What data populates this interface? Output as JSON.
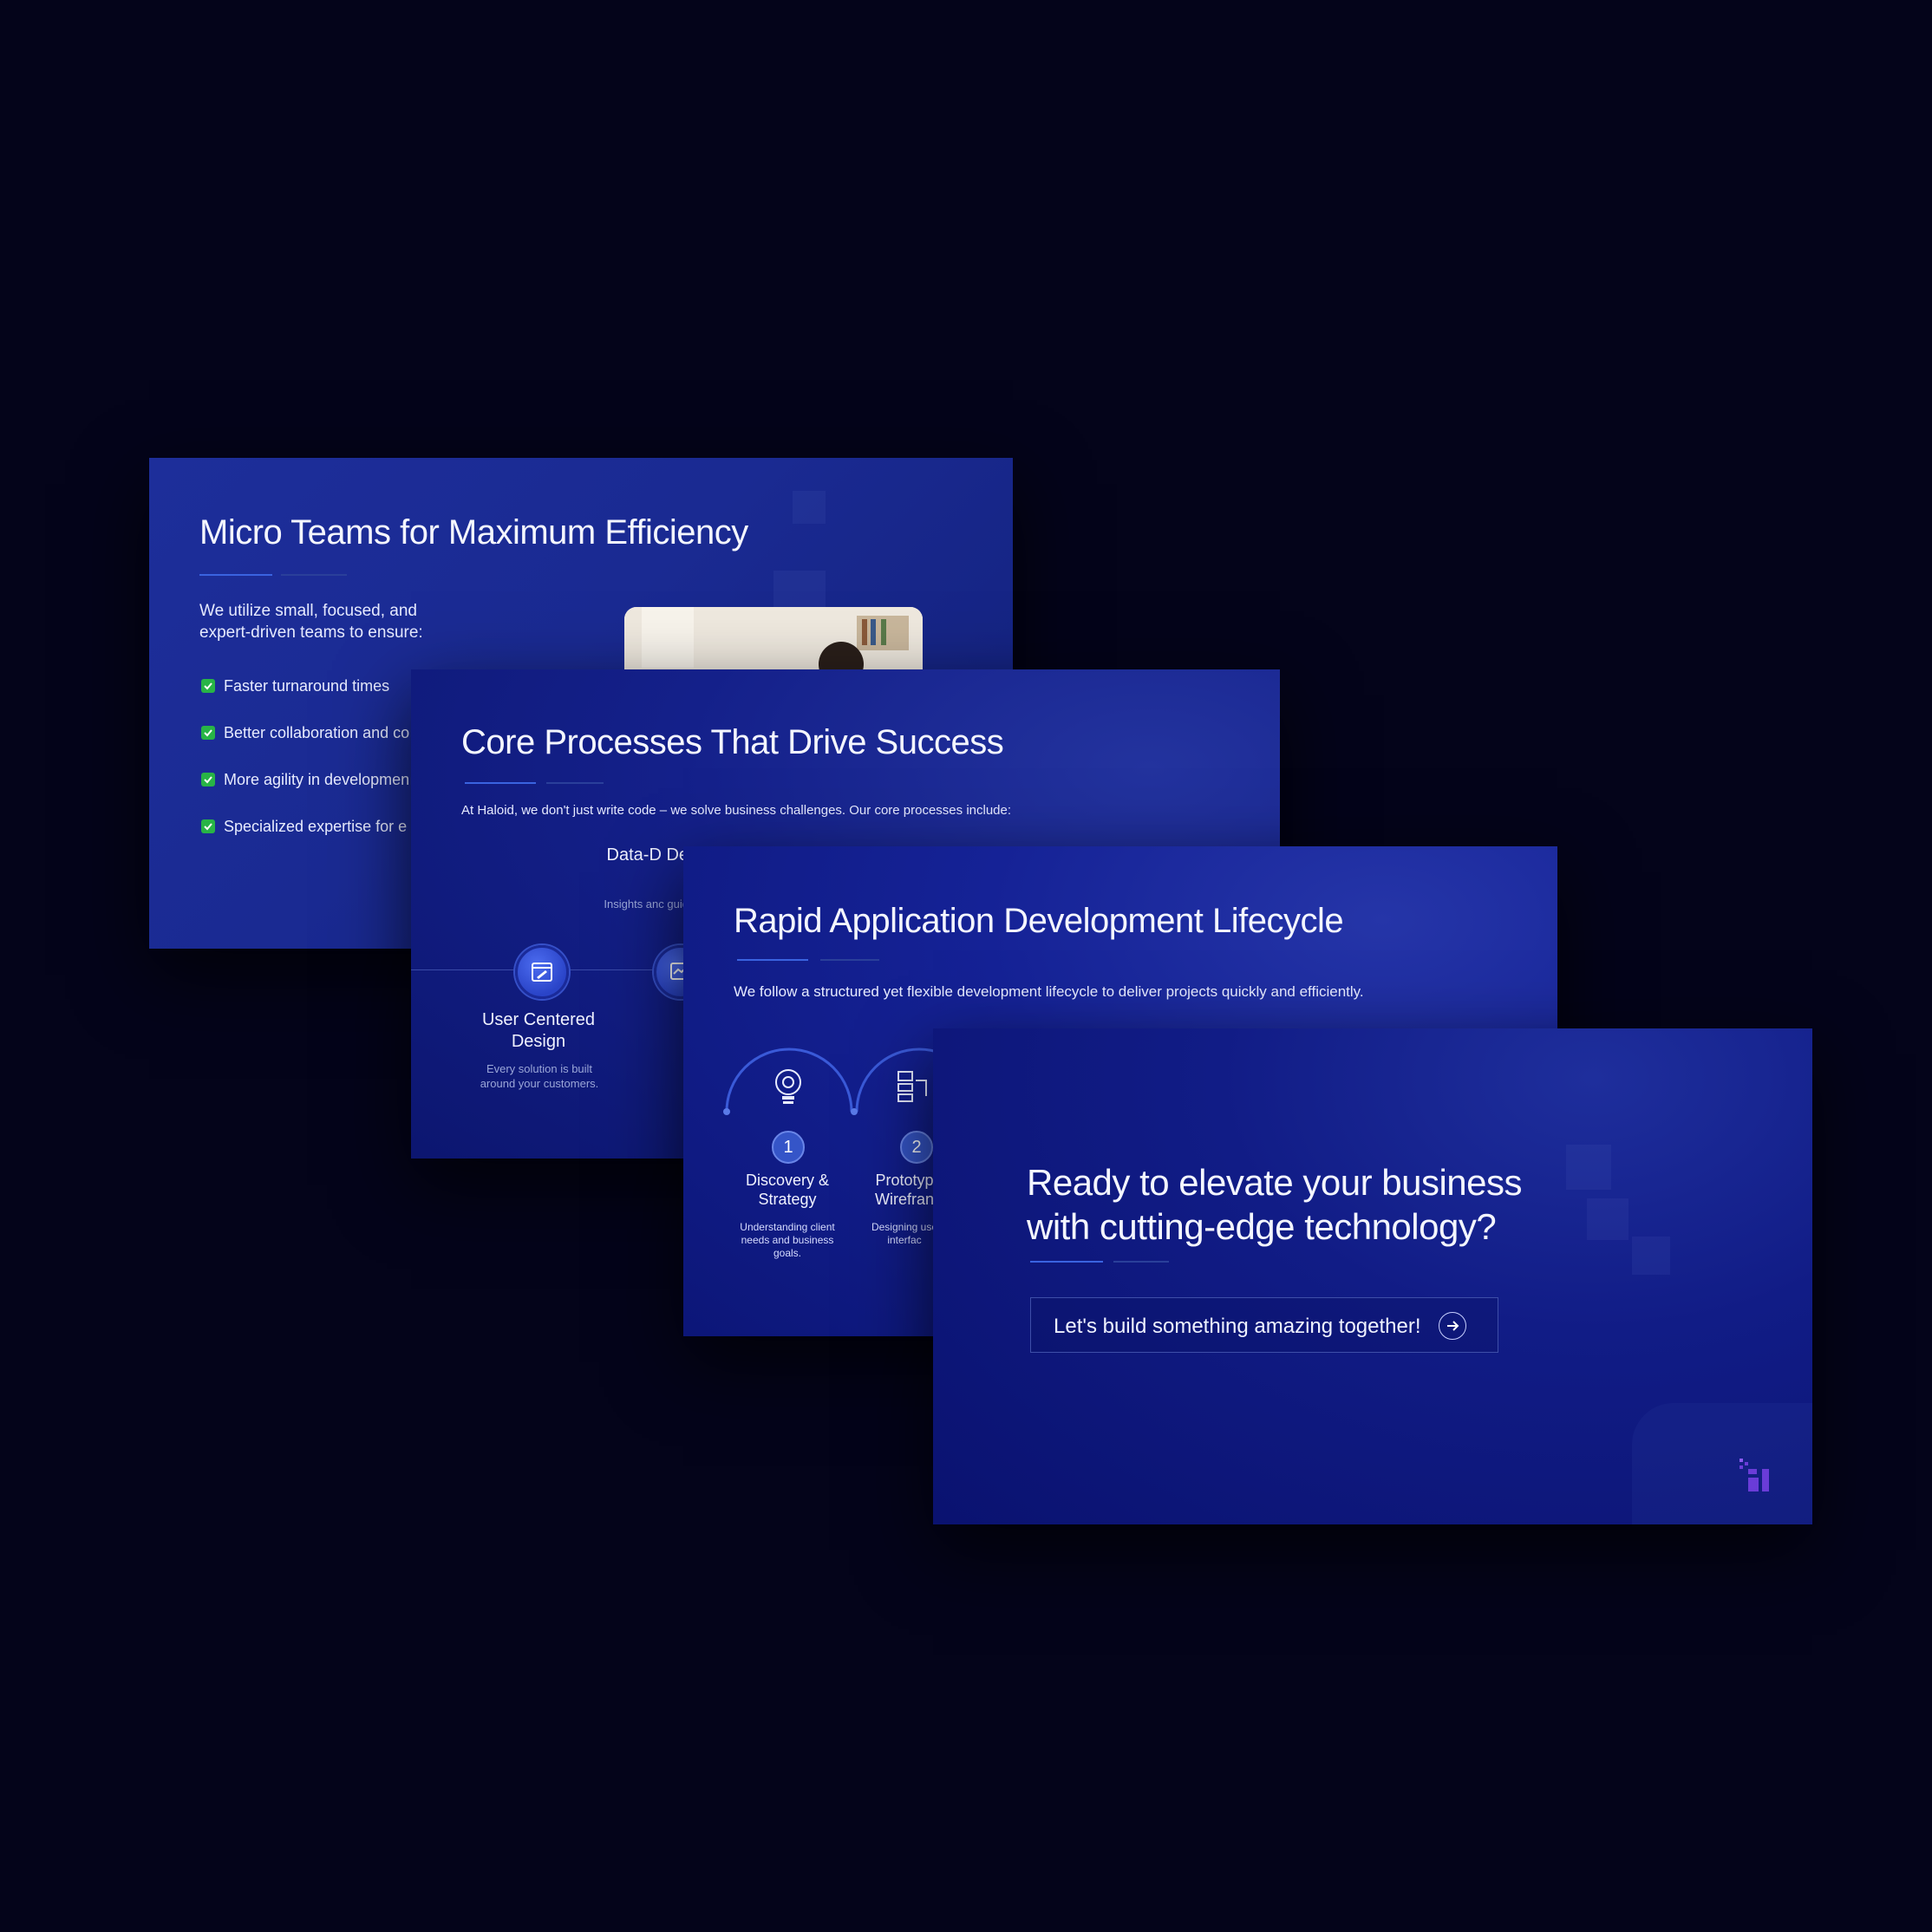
{
  "slide1": {
    "title": "Micro Teams for Maximum Efficiency",
    "intro": "We utilize small, focused, and expert-driven teams to ensure:",
    "checklist": [
      "Faster turnaround times",
      "Better collaboration and co",
      "More agility in developmen",
      "Specialized expertise for e"
    ]
  },
  "slide2": {
    "title": "Core Processes That Drive Success",
    "intro": "At Haloid, we don't just write code – we solve business challenges. Our core processes include:",
    "nodes": [
      {
        "title": "User Centered Design",
        "desc": "Every solution is built around your customers.",
        "icon": "design-icon"
      },
      {
        "title": "Data-D Decis",
        "desc": "Insights anc guide our",
        "icon": "dashboard-icon"
      }
    ]
  },
  "slide3": {
    "title": "Rapid Application Development Lifecycle",
    "intro": "We follow a structured yet flexible development lifecycle to deliver projects quickly and efficiently.",
    "steps": [
      {
        "number": "1",
        "title": "Discovery & Strategy",
        "desc": "Understanding client needs and business goals.",
        "icon": "lightbulb-icon"
      },
      {
        "number": "2",
        "title": "Prototyp Wirefran",
        "desc": "Designing use interfac",
        "icon": "wireframe-icon"
      }
    ]
  },
  "slide4": {
    "title": "Ready to elevate your business with cutting-edge technology?",
    "cta_label": "Let's build something amazing together!",
    "cta_icon": "arrow-right-icon",
    "logo_icon": "brand-logo-icon"
  },
  "colors": {
    "background": "#04041a",
    "slide_blue": "#1a2a92",
    "accent_line": "#3a63e0",
    "check_green": "#28b446",
    "logo_purple": "#6a3cd8"
  }
}
